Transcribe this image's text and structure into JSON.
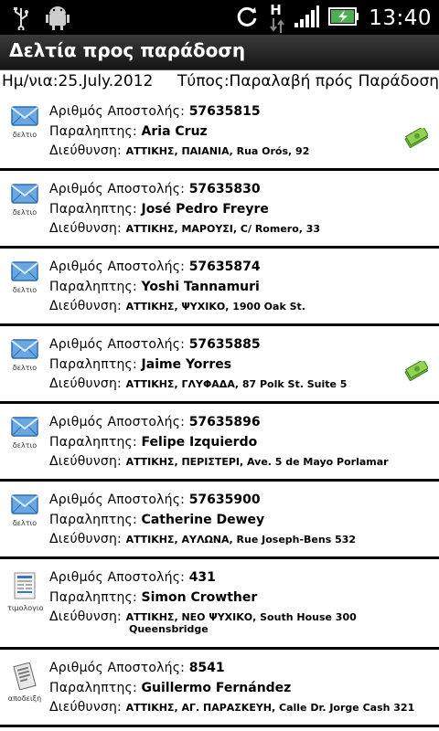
{
  "status_bar": {
    "icons": [
      "usb-icon",
      "android-debug-icon",
      "sync-icon",
      "h-signal-icon",
      "signal-bars-icon",
      "battery-charging-icon"
    ],
    "network_letter": "H",
    "time": "13:40"
  },
  "header": {
    "title": "Δελτία προς παράδοση"
  },
  "info": {
    "date": "Ημ/νια:25.July.2012",
    "type": "Τύπος:Παραλαβή πρός Παράδοση"
  },
  "labels": {
    "shipment": "Αριθμός Αποστολής: ",
    "recipient": "Παραληπτης: ",
    "address": "Διεύθυνση: "
  },
  "items": [
    {
      "icon": "envelope-icon",
      "caption": "δελτιο",
      "number": "57635815",
      "recipient": "Aria Cruz",
      "address": "ΑΤΤΙΚΗΣ, ΠΑΙΑΝΙΑ, Rua Orós, 92",
      "money": true
    },
    {
      "icon": "envelope-icon",
      "caption": "δελτιο",
      "number": "57635830",
      "recipient": "José Pedro Freyre",
      "address": "ΑΤΤΙΚΗΣ, ΜΑΡΟΥΣΙ, C/ Romero, 33",
      "money": false
    },
    {
      "icon": "envelope-icon",
      "caption": "δελτιο",
      "number": "57635874",
      "recipient": "Yoshi Tannamuri",
      "address": "ΑΤΤΙΚΗΣ, ΨΥΧΙΚΟ, 1900 Oak St.",
      "money": false
    },
    {
      "icon": "envelope-icon",
      "caption": "δελτιο",
      "number": "57635885",
      "recipient": "Jaime Yorres",
      "address": "ΑΤΤΙΚΗΣ, ΓΛΥΦΑΔΑ, 87 Polk St. Suite 5",
      "money": true
    },
    {
      "icon": "envelope-icon",
      "caption": "δελτιο",
      "number": "57635896",
      "recipient": "Felipe Izquierdo",
      "address": "ΑΤΤΙΚΗΣ, ΠΕΡΙΣΤΕΡΙ, Ave. 5 de Mayo Porlamar",
      "money": false
    },
    {
      "icon": "envelope-icon",
      "caption": "δελτιο",
      "number": "57635900",
      "recipient": "Catherine Dewey",
      "address": "ΑΤΤΙΚΗΣ, ΑΥΛΩΝΑ, Rue Joseph-Bens 532",
      "money": false
    },
    {
      "icon": "invoice-icon",
      "caption": "τιμολογιο",
      "number": "431",
      "recipient": "Simon Crowther",
      "address": "ΑΤΤΙΚΗΣ, ΝΕΟ ΨΥΧΙΚΟ, South House 300",
      "address2": "Queensbridge",
      "money": false
    },
    {
      "icon": "receipt-icon",
      "caption": "αποδειξη",
      "number": "8541",
      "recipient": "Guillermo Fernández",
      "address": "ΑΤΤΙΚΗΣ, ΑΓ. ΠΑΡΑΣΚΕΥΗ, Calle Dr. Jorge Cash 321",
      "money": false
    }
  ],
  "colors": {
    "status_bar": "#000000",
    "title_bar": "#222222",
    "envelope": "#5b9bd5",
    "money": "#6cbf3a"
  }
}
